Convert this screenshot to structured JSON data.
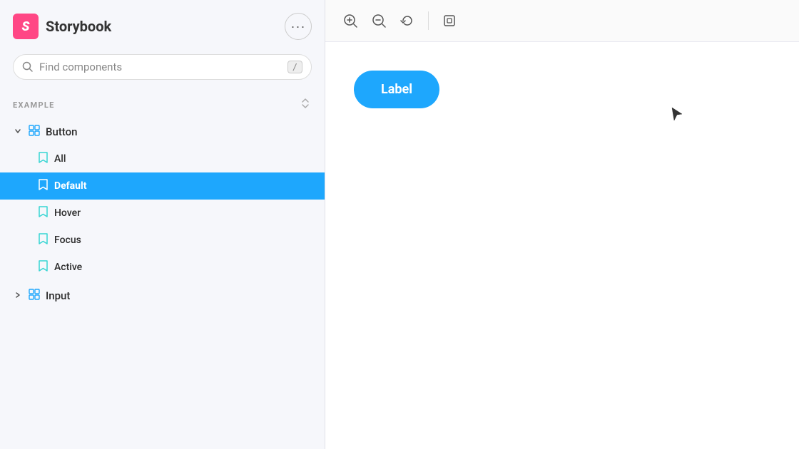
{
  "app": {
    "title": "Storybook",
    "logo_letter": "S"
  },
  "sidebar": {
    "more_button_label": "···",
    "search": {
      "placeholder": "Find components",
      "shortcut": "/"
    },
    "section": {
      "label": "EXAMPLE",
      "sort_icon": "⇅"
    },
    "tree": [
      {
        "id": "button",
        "label": "Button",
        "expanded": true,
        "stories": [
          {
            "id": "all",
            "label": "All",
            "active": false
          },
          {
            "id": "default",
            "label": "Default",
            "active": true
          },
          {
            "id": "hover",
            "label": "Hover",
            "active": false
          },
          {
            "id": "focus",
            "label": "Focus",
            "active": false
          },
          {
            "id": "active",
            "label": "Active",
            "active": false
          }
        ]
      },
      {
        "id": "input",
        "label": "Input",
        "expanded": false,
        "stories": []
      }
    ]
  },
  "canvas": {
    "zoom_in_label": "⊕",
    "zoom_out_label": "⊖",
    "zoom_reset_label": "↺",
    "frame_label": "⬚",
    "preview_button_label": "Label"
  },
  "icons": {
    "search": "🔍",
    "bookmark": "🔖",
    "chevron_down": "▾",
    "chevron_right": "▶"
  }
}
